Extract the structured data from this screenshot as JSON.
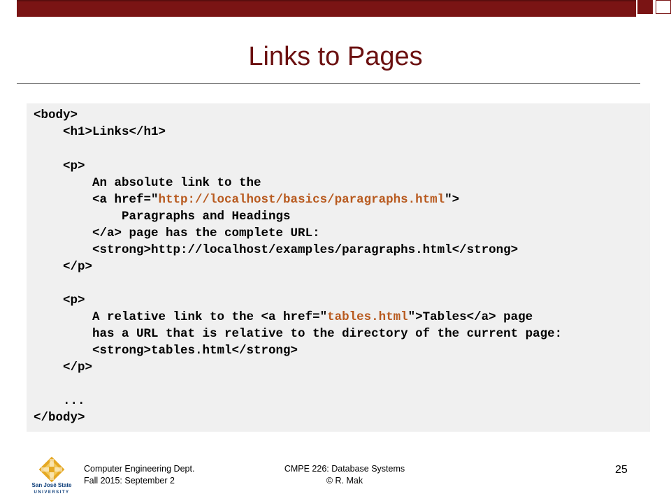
{
  "slide": {
    "title": "Links to Pages",
    "page_number": "25"
  },
  "code": {
    "l1": "<body>",
    "l2": "    <h1>Links</h1>",
    "l3": "    <p>",
    "l4": "        An absolute link to the",
    "l5_pre": "        <a href=\"",
    "l5_url": "http://localhost/basics/paragraphs.html",
    "l5_post": "\">",
    "l6": "            Paragraphs and Headings",
    "l7": "        </a> page has the complete URL:",
    "l8": "        <strong>http://localhost/examples/paragraphs.html</strong>",
    "l9": "    </p>",
    "l10": "    <p>",
    "l11_pre": "        A relative link to the <a href=\"",
    "l11_url": "tables.html",
    "l11_post": "\">Tables</a> page",
    "l12": "        has a URL that is relative to the directory of the current page:",
    "l13": "        <strong>tables.html</strong>",
    "l14": "    </p>",
    "l15": "    ...",
    "l16": "</body>"
  },
  "footer": {
    "left_line1": "Computer Engineering Dept.",
    "left_line2": "Fall 2015: September 2",
    "center_line1": "CMPE 226: Database Systems",
    "center_line2": "© R. Mak",
    "logo_text_line1": "San José State",
    "logo_text_line2": "UNIVERSITY"
  },
  "colors": {
    "accent": "#7a1414",
    "title": "#6b1010",
    "url": "#b85a1f",
    "code_bg": "#f0f0f0",
    "logo_gold": "#e5a823",
    "logo_blue": "#0d3e7a"
  },
  "icons": {
    "logo": "sjsu-logo-icon"
  }
}
